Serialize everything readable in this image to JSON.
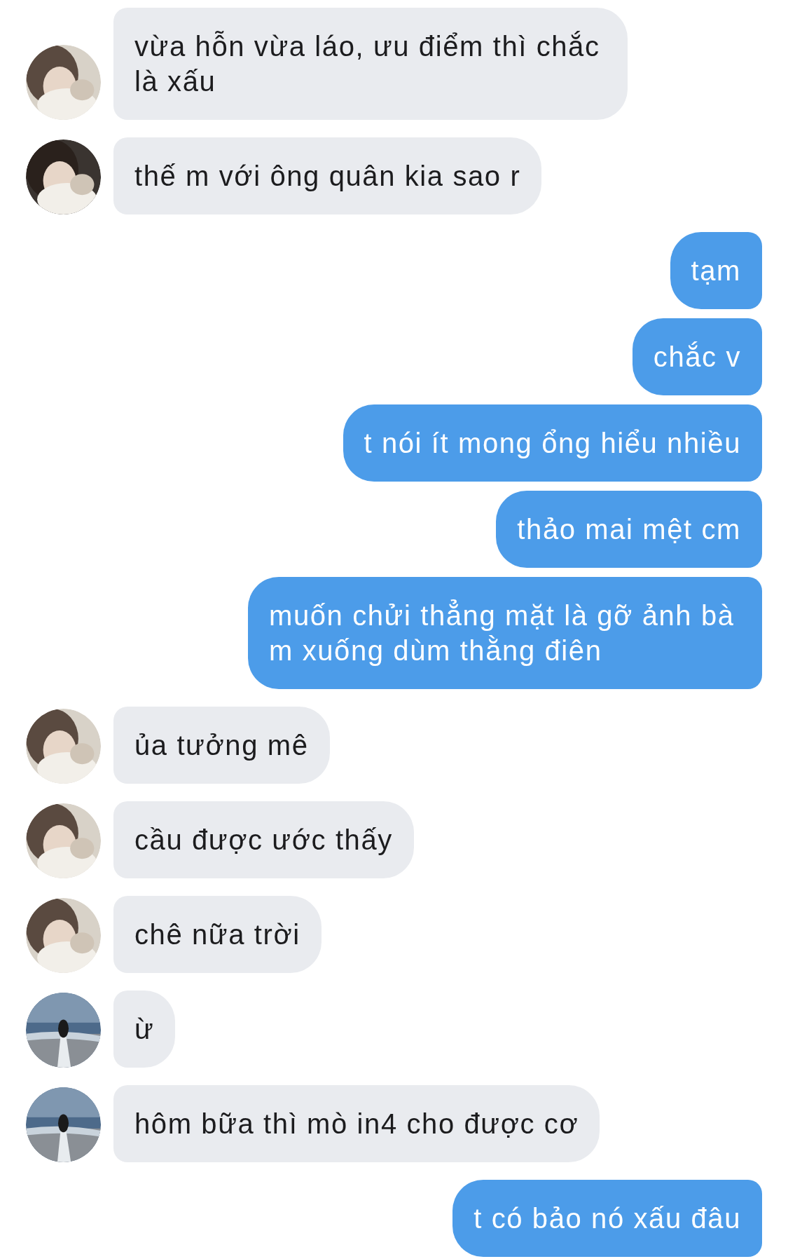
{
  "messages": [
    {
      "kind": "received",
      "text": "vừa hỗn vừa láo, ưu điểm thì chắc là xấu"
    },
    {
      "kind": "received",
      "text": "thế m với ông quân kia sao r"
    },
    {
      "kind": "sent",
      "text": "tạm"
    },
    {
      "kind": "sent",
      "text": "chắc v"
    },
    {
      "kind": "sent",
      "text": "t nói ít mong ổng hiểu nhiều"
    },
    {
      "kind": "sent",
      "text": "thảo mai mệt cm"
    },
    {
      "kind": "sent",
      "text": "muốn chửi thẳng mặt là gỡ ảnh bà m xuống dùm thằng điên"
    },
    {
      "kind": "received",
      "text": "ủa tưởng mê"
    },
    {
      "kind": "received",
      "text": "cầu được ước thấy"
    },
    {
      "kind": "received",
      "text": "chê nữa trời"
    },
    {
      "kind": "received",
      "text": "ừ"
    },
    {
      "kind": "received",
      "text": "hôm bữa thì mò in4 cho được cơ"
    },
    {
      "kind": "sent",
      "text": "t có bảo nó xấu đâu"
    }
  ]
}
